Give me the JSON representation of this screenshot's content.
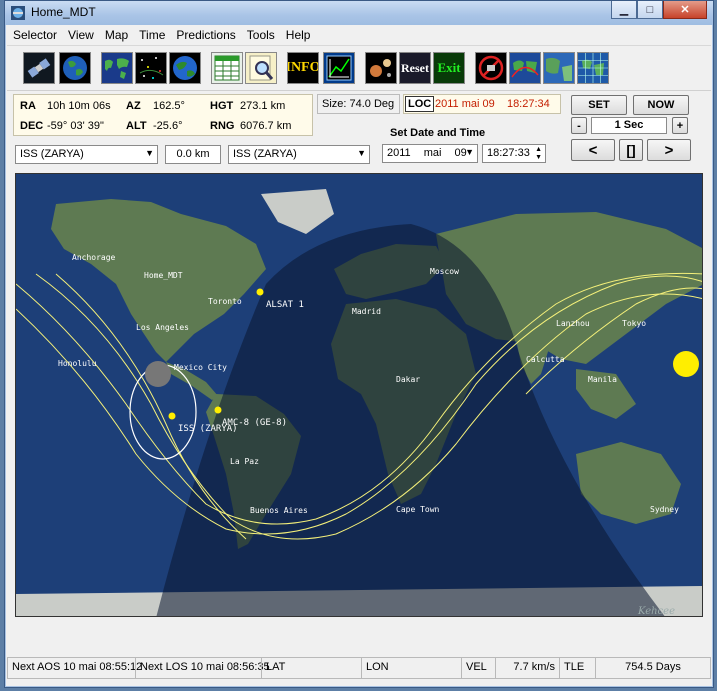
{
  "window": {
    "title": "Home_MDT"
  },
  "menu": [
    "Selector",
    "View",
    "Map",
    "Time",
    "Predictions",
    "Tools",
    "Help"
  ],
  "toolbar": {
    "buttons": [
      {
        "icon": "satellite-icon"
      },
      {
        "icon": "globe-icon"
      },
      {
        "icon": "world-map-icon"
      },
      {
        "icon": "star-map-icon"
      },
      {
        "icon": "globe-2-icon"
      },
      {
        "icon": "spreadsheet-icon"
      },
      {
        "icon": "magnifier-icon"
      },
      {
        "icon": "info-icon",
        "label": "INFO"
      },
      {
        "icon": "orbit-plot-icon"
      },
      {
        "icon": "planets-icon"
      },
      {
        "icon": "reset-icon",
        "label": "Reset"
      },
      {
        "icon": "exit-icon",
        "label": "Exit"
      },
      {
        "icon": "no-satellite-icon"
      },
      {
        "icon": "ground-track-icon"
      },
      {
        "icon": "earth-view-icon"
      },
      {
        "icon": "grid-map-icon"
      }
    ]
  },
  "info": {
    "ra_label": "RA",
    "ra": "10h 10m 06s",
    "az_label": "AZ",
    "az": "162.5°",
    "hgt_label": "HGT",
    "hgt": "273.1 km",
    "dec_label": "DEC",
    "dec": "-59° 03' 39\"",
    "alt_label": "ALT",
    "alt": "-25.6°",
    "rng_label": "RNG",
    "rng": "6076.7 km",
    "size": "Size: 74.0 Deg",
    "loc_label": "LOC",
    "loc_datetime": "2011 mai 09    18:27:34"
  },
  "controls": {
    "set_label": "SET",
    "now_label": "NOW",
    "minus_label": "-",
    "step": "1 Sec",
    "plus_label": "+",
    "prev_label": "<",
    "pause_label": "[]",
    "next_label": ">",
    "set_date_time_label": "Set  Date and Time",
    "date_year": "2011",
    "date_month": "mai",
    "date_day": "09",
    "time": "18:27:33",
    "left_sat": "ISS (ZARYA)",
    "distance": "0.0 km",
    "right_sat": "ISS (ZARYA)"
  },
  "map": {
    "cities": [
      {
        "name": "Anchorage"
      },
      {
        "name": "Home_MDT"
      },
      {
        "name": "Toronto"
      },
      {
        "name": "Los Angeles"
      },
      {
        "name": "Honolulu"
      },
      {
        "name": "Mexico City"
      },
      {
        "name": "La Paz"
      },
      {
        "name": "Buenos Aires"
      },
      {
        "name": "Madrid"
      },
      {
        "name": "Moscow"
      },
      {
        "name": "Dakar"
      },
      {
        "name": "Cape Town"
      },
      {
        "name": "Lanzhou"
      },
      {
        "name": "Tokyo"
      },
      {
        "name": "Calcutta"
      },
      {
        "name": "Manila"
      },
      {
        "name": "Sydney"
      }
    ],
    "satellites": [
      {
        "name": "ALSAT 1"
      },
      {
        "name": "ISS (ZARYA)"
      },
      {
        "name": "AMC-8 (GE-8)"
      }
    ],
    "watermark": "Kehcee",
    "colors": {
      "ocean": "#1d3f78",
      "night": "#0a1530",
      "track": "#f4f07a",
      "sun": "#ffee00",
      "footprint": "#ffffff"
    }
  },
  "status": {
    "next_aos": "Next AOS 10 mai 08:55:12",
    "next_los": "Next LOS 10 mai 08:56:35",
    "lat_label": "LAT",
    "lat": "",
    "lon_label": "LON",
    "lon": "",
    "vel_label": "VEL",
    "vel": "7.7 km/s",
    "tle_label": "TLE",
    "tle": "754.5 Days"
  }
}
